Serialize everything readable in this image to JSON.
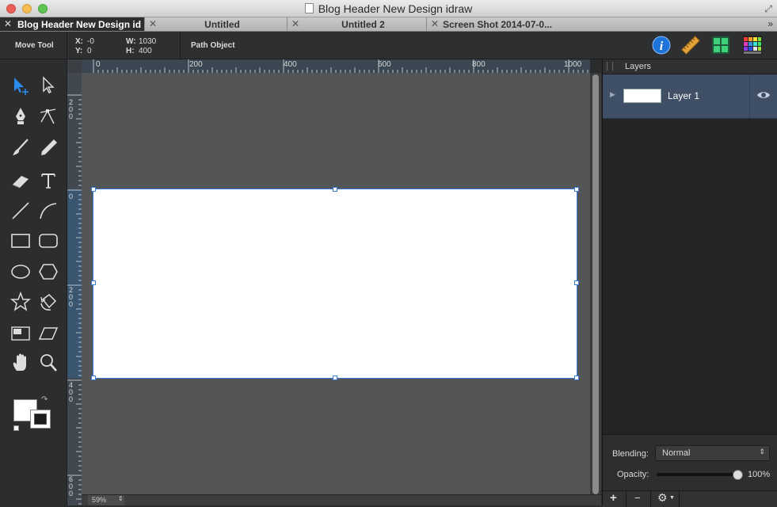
{
  "window": {
    "title": "Blog Header New Design idraw"
  },
  "tabs": [
    {
      "label": "Blog Header New Design idraw"
    },
    {
      "label": "Untitled"
    },
    {
      "label": "Untitled 2"
    },
    {
      "label": "Screen Shot 2014-07-0..."
    }
  ],
  "tab_overflow": "»",
  "options_bar": {
    "tool_name": "Move Tool",
    "x_label": "X:",
    "x_value": "-0",
    "y_label": "Y:",
    "y_value": "0",
    "w_label": "W:",
    "w_value": "1030",
    "h_label": "H:",
    "h_value": "400",
    "selection_type": "Path Object"
  },
  "toolbar_icons": [
    "info-icon",
    "ruler-icon",
    "grid-view-icon",
    "color-swatches-icon"
  ],
  "tools": [
    "select-tool",
    "direct-select-tool",
    "pen-tool",
    "bezier-node-tool",
    "brush-tool",
    "pencil-tool",
    "eraser-tool",
    "text-tool",
    "line-tool",
    "arc-tool",
    "rectangle-tool",
    "rounded-rectangle-tool",
    "ellipse-tool",
    "polygon-tool",
    "star-tool",
    "rotate-tool",
    "slice-tool",
    "skew-tool",
    "hand-tool",
    "zoom-tool"
  ],
  "rulers": {
    "horizontal": [
      "0",
      "200",
      "400",
      "600",
      "800",
      "1000"
    ],
    "vertical": [
      "200",
      "0",
      "200",
      "400",
      "600"
    ]
  },
  "canvas": {
    "zoom": "59%"
  },
  "layers_panel": {
    "title": "Layers",
    "layers": [
      {
        "name": "Layer 1",
        "visible": true
      }
    ],
    "blending_label": "Blending:",
    "blending_value": "Normal",
    "opacity_label": "Opacity:",
    "opacity_value": "100%",
    "opacity_fraction": 1.0,
    "add_label": "+",
    "remove_label": "−"
  },
  "colors": {
    "selection": "#3a7bd5",
    "layer_selected_bg": "#3f4f66",
    "canvas_bg": "#545557"
  }
}
